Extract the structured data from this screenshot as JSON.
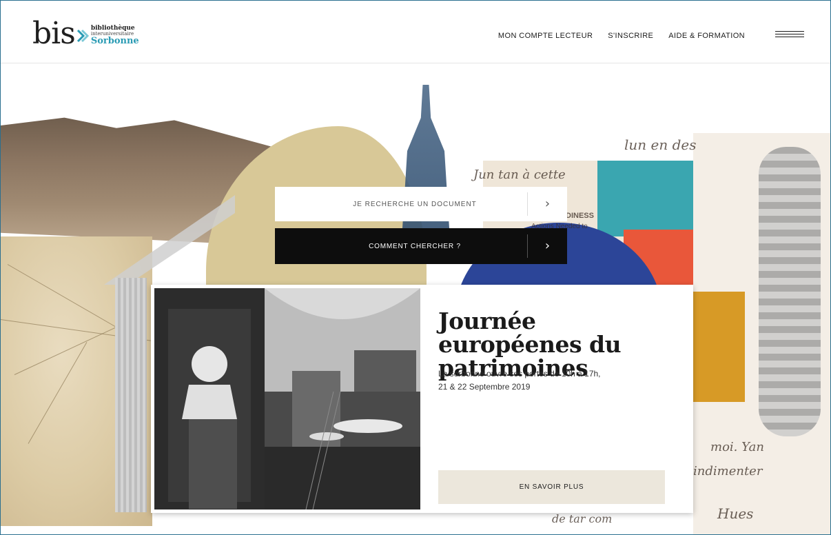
{
  "logo": {
    "mark": "bis",
    "line1": "bibliothèque",
    "line2": "interuniversitaire",
    "line3": "Sorbonne",
    "accent_color": "#2a9bb4"
  },
  "nav": {
    "items": [
      {
        "label": "MON COMPTE LECTEUR"
      },
      {
        "label": "S'INSCRIRE"
      },
      {
        "label": "AIDE & FORMATION"
      }
    ],
    "menu_icon": "hamburger-icon"
  },
  "search": {
    "label": "JE RECHERCHE UN DOCUMENT",
    "arrow_icon": "chevron-right-icon"
  },
  "howto": {
    "label": "COMMENT CHERCHER ?",
    "arrow_icon": "chevron-right-icon"
  },
  "feature": {
    "title": "Journée européenes du patrimoines",
    "description_line1": "La sorbonne ouvre ses portes de 10h à 17h,",
    "description_line2": "21 & 22 Septembre 2019",
    "button_label": "EN SAVOIR PLUS",
    "button_color": "#ece7dc"
  },
  "collage": {
    "script_fragments": [
      "lun en des",
      "Jun tan à cette",
      "Actions Needed to",
      "DINESS",
      "moi. Yan",
      "indimenter",
      "de tar com",
      "Hues"
    ]
  }
}
